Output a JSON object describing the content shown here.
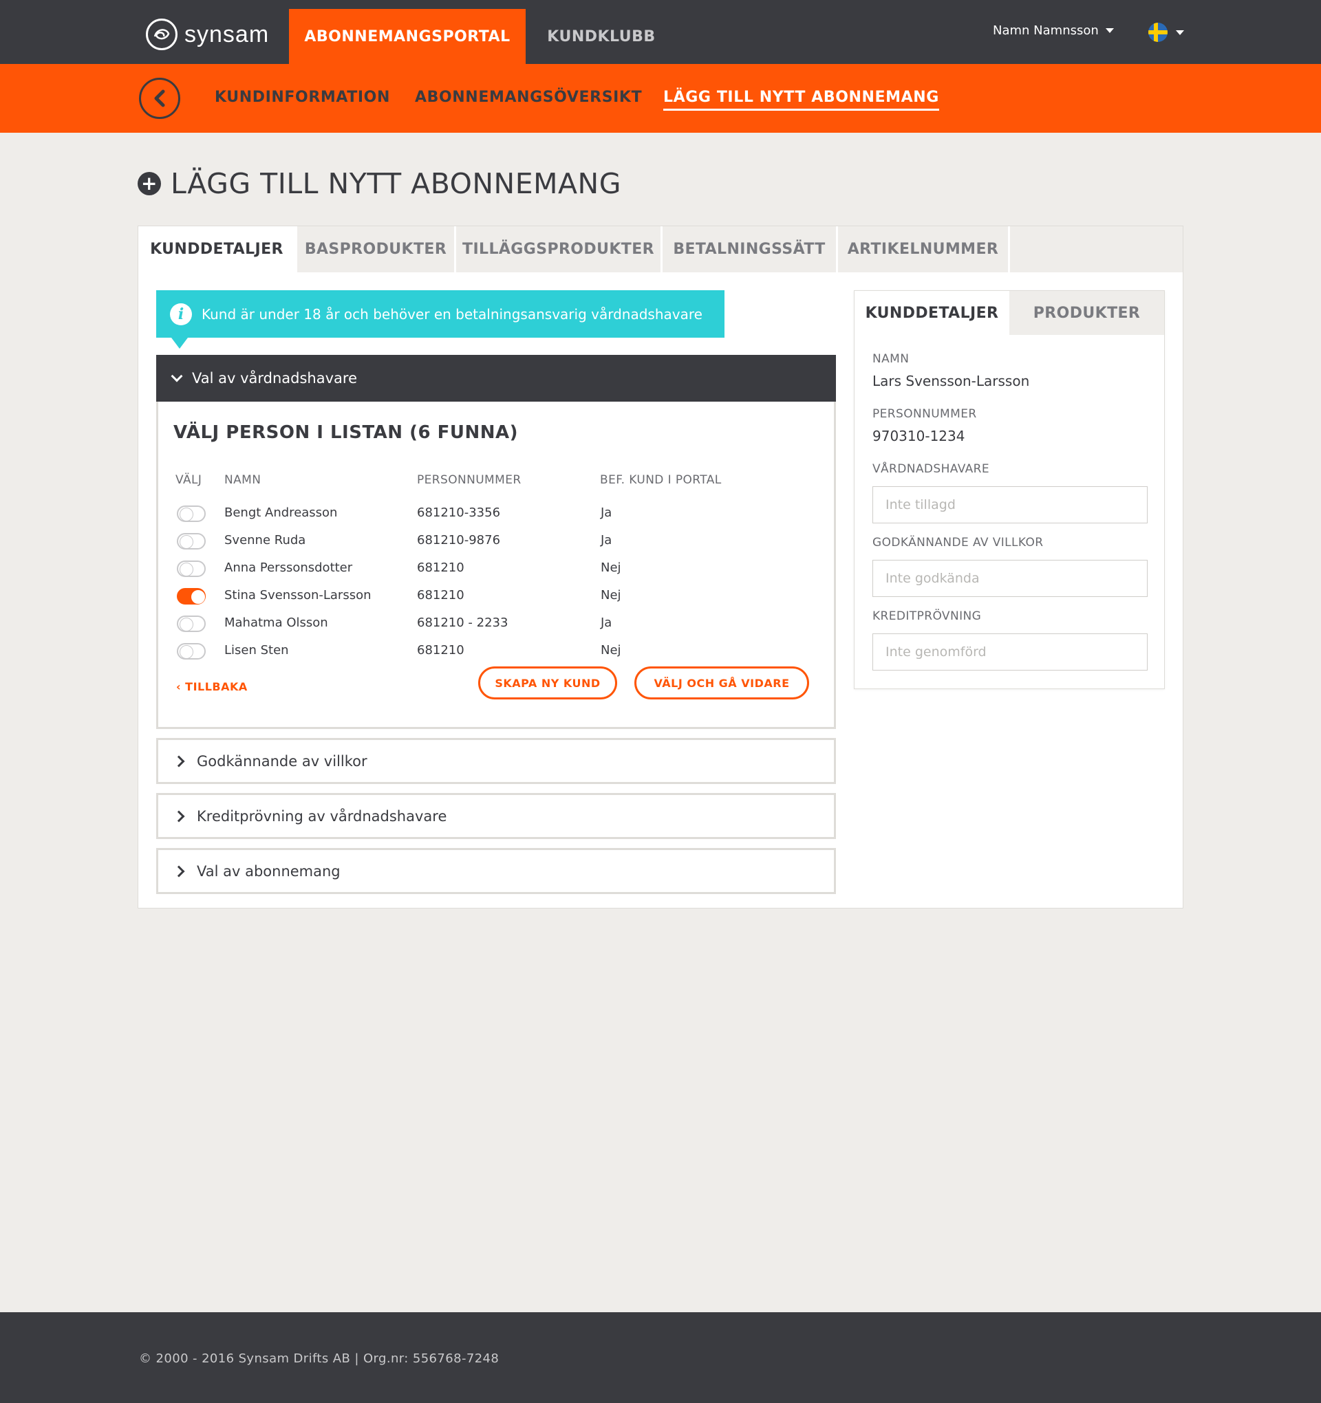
{
  "brand": {
    "logo_text": "synsam",
    "accent": "#ff5506",
    "dark": "#3a3b40",
    "info": "#2ecfd6"
  },
  "topnav": {
    "items": [
      {
        "label": "ABONNEMANGSPORTAL",
        "active": true
      },
      {
        "label": "KUNDKLUBB",
        "active": false
      }
    ],
    "user_name": "Namn Namnsson",
    "language_icon": "swedish-flag-icon"
  },
  "subnav": {
    "back_icon": "chevron-left-icon",
    "items": [
      {
        "label": "KUNDINFORMATION",
        "active": false
      },
      {
        "label": "ABONNEMANGSÖVERSIKT",
        "active": false
      },
      {
        "label": "LÄGG TILL NYTT ABONNEMANG",
        "active": true
      }
    ]
  },
  "page": {
    "title": "LÄGG TILL NYTT ABONNEMANG",
    "title_icon": "plus-circle-icon"
  },
  "tabs": [
    {
      "label": "KUNDDETALJER",
      "active": true
    },
    {
      "label": "BASPRODUKTER",
      "active": false
    },
    {
      "label": "TILLÄGGSPRODUKTER",
      "active": false
    },
    {
      "label": "BETALNINGSSÄTT",
      "active": false
    },
    {
      "label": "ARTIKELNUMMER",
      "active": false
    }
  ],
  "info_banner": {
    "icon": "info-icon",
    "text": "Kund är under 18 år och behöver en betalningsansvarig vårdnadshavare"
  },
  "guardian_section": {
    "header": "Val av vårdnadshavare",
    "list_title": "VÄLJ PERSON I LISTAN (6 FUNNA)",
    "columns": [
      "VÄLJ",
      "NAMN",
      "PERSONNUMMER",
      "BEF. KUND I PORTAL"
    ],
    "rows": [
      {
        "selected": false,
        "name": "Bengt Andreasson",
        "ssn": "681210-3356",
        "existing": "Ja"
      },
      {
        "selected": false,
        "name": "Svenne Ruda",
        "ssn": "681210-9876",
        "existing": "Ja"
      },
      {
        "selected": false,
        "name": "Anna Perssonsdotter",
        "ssn": "681210",
        "existing": "Nej"
      },
      {
        "selected": true,
        "name": "Stina Svensson-Larsson",
        "ssn": "681210",
        "existing": "Nej"
      },
      {
        "selected": false,
        "name": "Mahatma Olsson",
        "ssn": "681210 - 2233",
        "existing": "Ja"
      },
      {
        "selected": false,
        "name": "Lisen Sten",
        "ssn": "681210",
        "existing": "Nej"
      }
    ],
    "back_label": "TILLBAKA",
    "create_button": "SKAPA NY KUND",
    "continue_button": "VÄLJ OCH GÅ VIDARE"
  },
  "collapsed_sections": [
    "Godkännande av villkor",
    "Kreditprövning av vårdnadshavare",
    "Val av abonnemang"
  ],
  "side_panel": {
    "tabs": [
      {
        "label": "KUNDDETALJER",
        "active": true
      },
      {
        "label": "PRODUKTER",
        "active": false
      }
    ],
    "name_label": "NAMN",
    "name_value": "Lars Svensson-Larsson",
    "ssn_label": "PERSONNUMMER",
    "ssn_value": "970310-1234",
    "guardian_label": "VÅRDNADSHAVARE",
    "guardian_placeholder": "Inte tillagd",
    "terms_label": "GODKÄNNANDE AV VILLKOR",
    "terms_placeholder": "Inte godkända",
    "credit_label": "KREDITPRÖVNING",
    "credit_placeholder": "Inte genomförd"
  },
  "footer": {
    "text": "© 2000 - 2016 Synsam Drifts AB   |   Org.nr: 556768-7248"
  }
}
